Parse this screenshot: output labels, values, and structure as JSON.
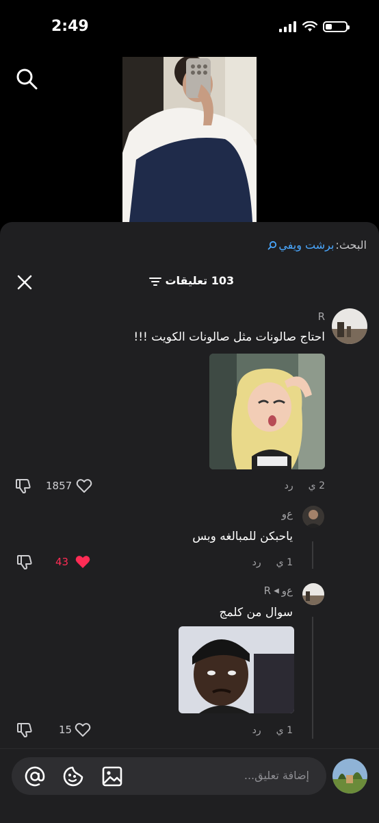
{
  "status_bar": {
    "time": "2:49"
  },
  "search_hint": {
    "label": "البحث:",
    "keyword": "برشت ويفي"
  },
  "header": {
    "comment_count_label": "103 تعليقات"
  },
  "comments": [
    {
      "username": "R",
      "text": "احتاج صالونات مثل صالونات الكويت !!!",
      "time": "2 ي",
      "reply_label": "رد",
      "likes": "1857",
      "liked": false
    }
  ],
  "replies": [
    {
      "username": "ﻉﻭ",
      "text": "ياحبكن للمبالغه وبس",
      "time": "1 ي",
      "reply_label": "رد",
      "likes": "43",
      "liked": true
    },
    {
      "username": "ﻉﻭ",
      "reply_to": "R",
      "text": "سوال من كلمج",
      "time": "1 ي",
      "reply_label": "رد",
      "likes": "15",
      "liked": false
    }
  ],
  "composer": {
    "placeholder": "إضافة تعليق..."
  },
  "colors": {
    "accent_blue": "#4aa8ff",
    "like_red": "#fe2c55",
    "sheet_bg": "#1f1f21"
  }
}
